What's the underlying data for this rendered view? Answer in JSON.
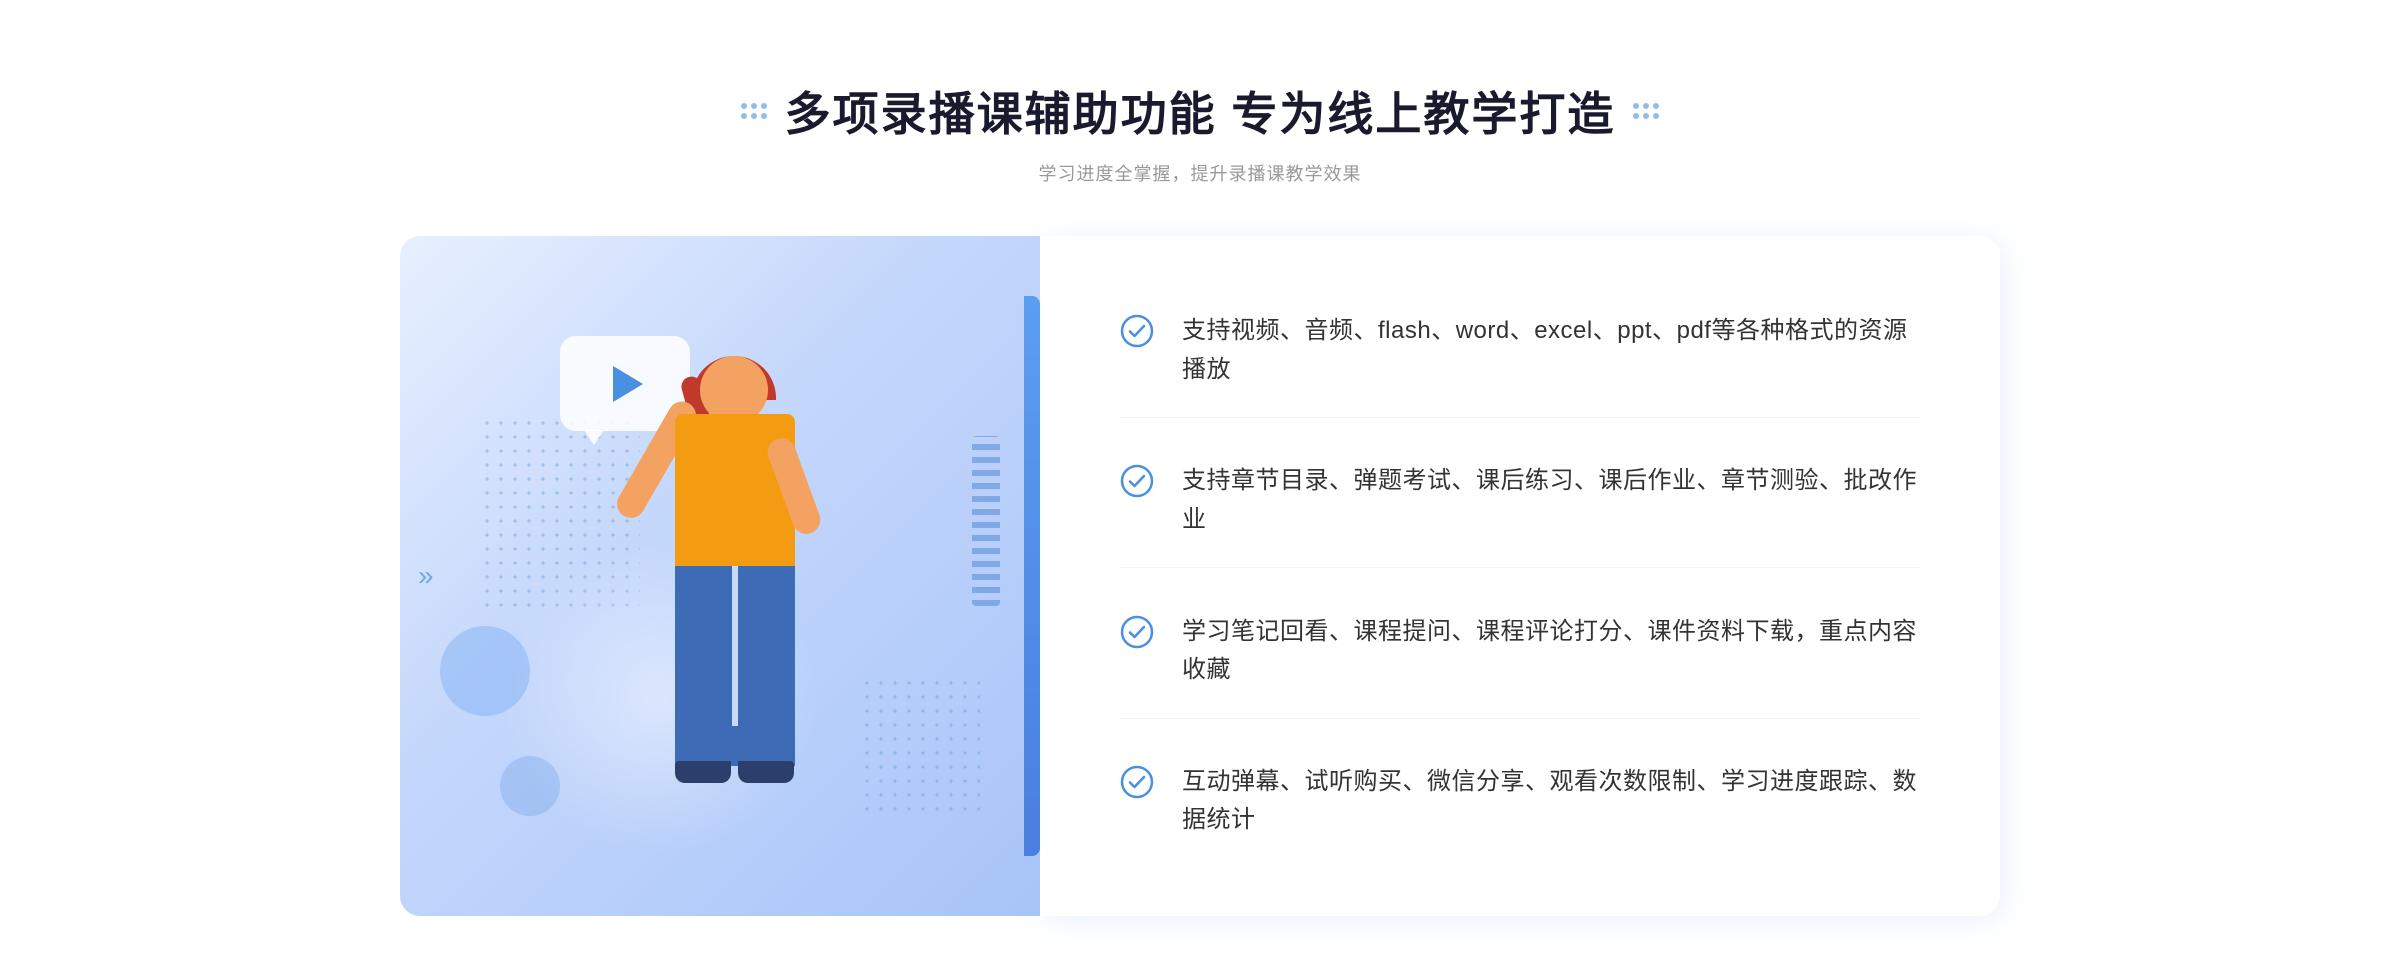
{
  "header": {
    "title": "多项录播课辅助功能 专为线上教学打造",
    "subtitle": "学习进度全掌握，提升录播课教学效果",
    "dots_left": "⁚⁚",
    "dots_right": "⁚⁚"
  },
  "features": [
    {
      "id": "feature-1",
      "text": "支持视频、音频、flash、word、excel、ppt、pdf等各种格式的资源播放"
    },
    {
      "id": "feature-2",
      "text": "支持章节目录、弹题考试、课后练习、课后作业、章节测验、批改作业"
    },
    {
      "id": "feature-3",
      "text": "学习笔记回看、课程提问、课程评论打分、课件资料下载，重点内容收藏"
    },
    {
      "id": "feature-4",
      "text": "互动弹幕、试听购买、微信分享、观看次数限制、学习进度跟踪、数据统计"
    }
  ],
  "chevrons": "«",
  "check_icon_color": "#4a90e2"
}
